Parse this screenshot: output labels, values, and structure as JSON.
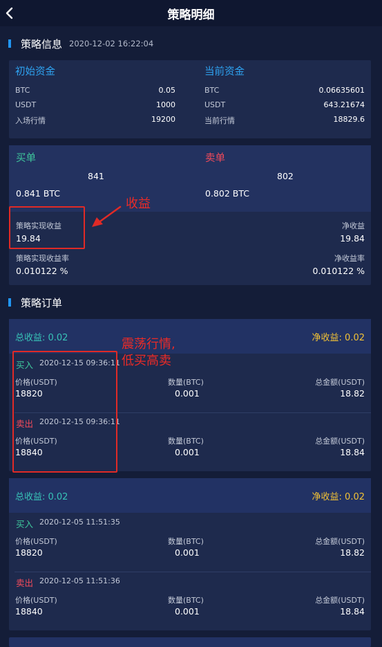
{
  "header": {
    "title": "策略明细"
  },
  "strategy_info": {
    "title": "策略信息",
    "time": "2020-12-02 16:22:04",
    "initial": {
      "label": "初始资金",
      "rows": [
        {
          "key": "BTC",
          "value": "0.05"
        },
        {
          "key": "USDT",
          "value": "1000"
        },
        {
          "key": "入场行情",
          "value": "19200"
        }
      ]
    },
    "current": {
      "label": "当前资金",
      "rows": [
        {
          "key": "BTC",
          "value": "0.06635601"
        },
        {
          "key": "USDT",
          "value": "643.21674"
        },
        {
          "key": "当前行情",
          "value": "18829.6"
        }
      ]
    }
  },
  "summary": {
    "buy": {
      "label": "买单",
      "count": "841",
      "amount": "0.841 BTC"
    },
    "sell": {
      "label": "卖单",
      "count": "802",
      "amount": "0.802 BTC"
    },
    "realized": {
      "label": "策略实现收益",
      "value": "19.84"
    },
    "net": {
      "label": "净收益",
      "value": "19.84"
    },
    "realized_rate": {
      "label": "策略实现收益率",
      "value": "0.010122 %"
    },
    "net_rate": {
      "label": "净收益率",
      "value": "0.010122 %"
    }
  },
  "orders_section": {
    "title": "策略订单"
  },
  "orders": [
    {
      "total": "总收益: 0.02",
      "net": "净收益: 0.02",
      "entries": [
        {
          "side": "买入",
          "time": "2020-12-15 09:36:11",
          "price_label": "价格(USDT)",
          "price": "18820",
          "qty_label": "数量(BTC)",
          "qty": "0.001",
          "amount_label": "总金额(USDT)",
          "amount": "18.82"
        },
        {
          "side": "卖出",
          "time": "2020-12-15 09:36:11",
          "price_label": "价格(USDT)",
          "price": "18840",
          "qty_label": "数量(BTC)",
          "qty": "0.001",
          "amount_label": "总金额(USDT)",
          "amount": "18.84"
        }
      ]
    },
    {
      "total": "总收益: 0.02",
      "net": "净收益: 0.02",
      "entries": [
        {
          "side": "买入",
          "time": "2020-12-05 11:51:35",
          "price_label": "价格(USDT)",
          "price": "18820",
          "qty_label": "数量(BTC)",
          "qty": "0.001",
          "amount_label": "总金额(USDT)",
          "amount": "18.82"
        },
        {
          "side": "卖出",
          "time": "2020-12-05 11:51:36",
          "price_label": "价格(USDT)",
          "price": "18840",
          "qty_label": "数量(BTC)",
          "qty": "0.001",
          "amount_label": "总金额(USDT)",
          "amount": "18.84"
        }
      ]
    }
  ],
  "annotations": {
    "profit_note": "收益",
    "oscillation_note": "震荡行情,\n低买高卖"
  },
  "colors": {
    "background": "#141d38",
    "card": "#1e2a4d",
    "accent_blue": "#2ea2f0",
    "buy_green": "#3fc69c",
    "sell_red": "#f04a5a",
    "total_teal": "#38c3b7",
    "net_yellow": "#f3c235",
    "annotation_red": "#e02a26"
  },
  "icons": {
    "back": "chevron-left-icon",
    "section_marker": "section-bar-icon"
  }
}
